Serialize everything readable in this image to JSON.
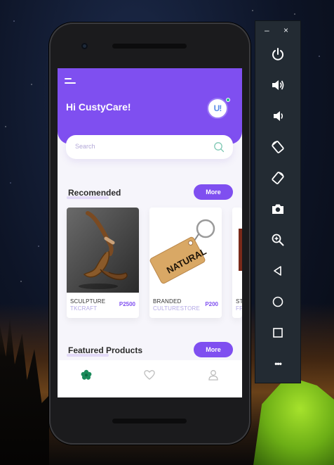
{
  "app": {
    "greeting": "Hi CustyCare!",
    "avatar_initials": "U!",
    "search_placeholder": "Search"
  },
  "sections": {
    "recommended": {
      "title": "Recomended",
      "more_label": "More"
    },
    "featured": {
      "title": "Featured Products",
      "more_label": "More"
    }
  },
  "products": [
    {
      "name": "SCULPTURE",
      "store": "TKCRAFT",
      "price": "P2500"
    },
    {
      "name": "BRANDED",
      "store": "CULTURESTORE",
      "price": "P200"
    },
    {
      "name": "ST",
      "store": "FF",
      "price": ""
    }
  ],
  "keychain_text": "NATURAL",
  "bottom_nav": {
    "items": [
      "home-icon",
      "heart-icon",
      "profile-icon"
    ]
  },
  "emulator_panel": {
    "minimize": "–",
    "close": "×",
    "buttons": [
      "power-icon",
      "volume-up-icon",
      "volume-down-icon",
      "rotate-left-icon",
      "rotate-right-icon",
      "camera-icon",
      "zoom-icon",
      "back-icon",
      "home-circle-icon",
      "overview-icon",
      "more-icon"
    ],
    "more_glyph": "•••"
  },
  "colors": {
    "accent": "#7f4ff0",
    "nav_active": "#1a8a5a",
    "status_dot": "#22c28a"
  }
}
